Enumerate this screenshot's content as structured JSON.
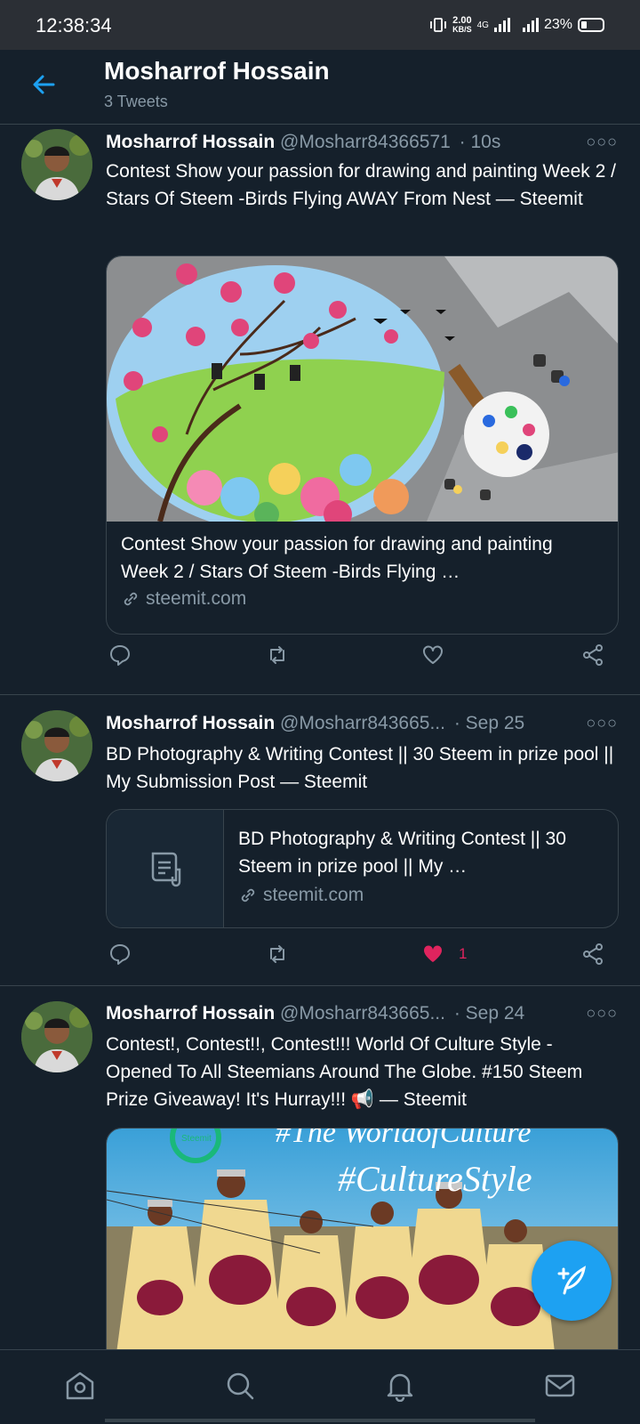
{
  "status_bar": {
    "time": "12:38:34",
    "net_speed": "2.00",
    "net_unit": "KB/S",
    "network": "4G",
    "battery": "23%"
  },
  "header": {
    "title": "Mosharrof Hossain",
    "subtitle": "3 Tweets"
  },
  "tweets": [
    {
      "name": "Mosharrof Hossain",
      "handle": "@Mosharr84366571",
      "time": "· 10s",
      "more": "○○○",
      "text": "Contest Show your passion for drawing and painting Week 2 / Stars Of Steem -Birds Flying AWAY  From Nest — Steemit",
      "card": {
        "title": "Contest Show your passion for drawing and painting Week 2 / Stars Of Steem -Birds Flying …",
        "domain": "steemit.com"
      },
      "likes": ""
    },
    {
      "name": "Mosharrof Hossain",
      "handle": "@Mosharr843665...",
      "time": "· Sep 25",
      "more": "○○○",
      "text": "BD Photography & Writing Contest || 30 Steem in prize pool || My Submission Post — Steemit",
      "card": {
        "title": "BD Photography & Writing Contest || 30 Steem in prize pool || My …",
        "domain": "steemit.com"
      },
      "likes": "1"
    },
    {
      "name": "Mosharrof Hossain",
      "handle": "@Mosharr843665...",
      "time": "· Sep 24",
      "more": "○○○",
      "text": "Contest!, Contest!!, Contest!!! World  Of Culture Style - Opened To All Steemians Around The Globe. #150 Steem  Prize Giveaway! It's Hurray!!! 📢 — Steemit",
      "image_text": {
        "line1": "#The WorldofCulture",
        "line2": "#CultureStyle",
        "badge": "Steemit"
      }
    }
  ],
  "colors": {
    "background": "#15202b",
    "accent": "#1da1f2",
    "like": "#e0245e",
    "muted": "#8899a6"
  }
}
